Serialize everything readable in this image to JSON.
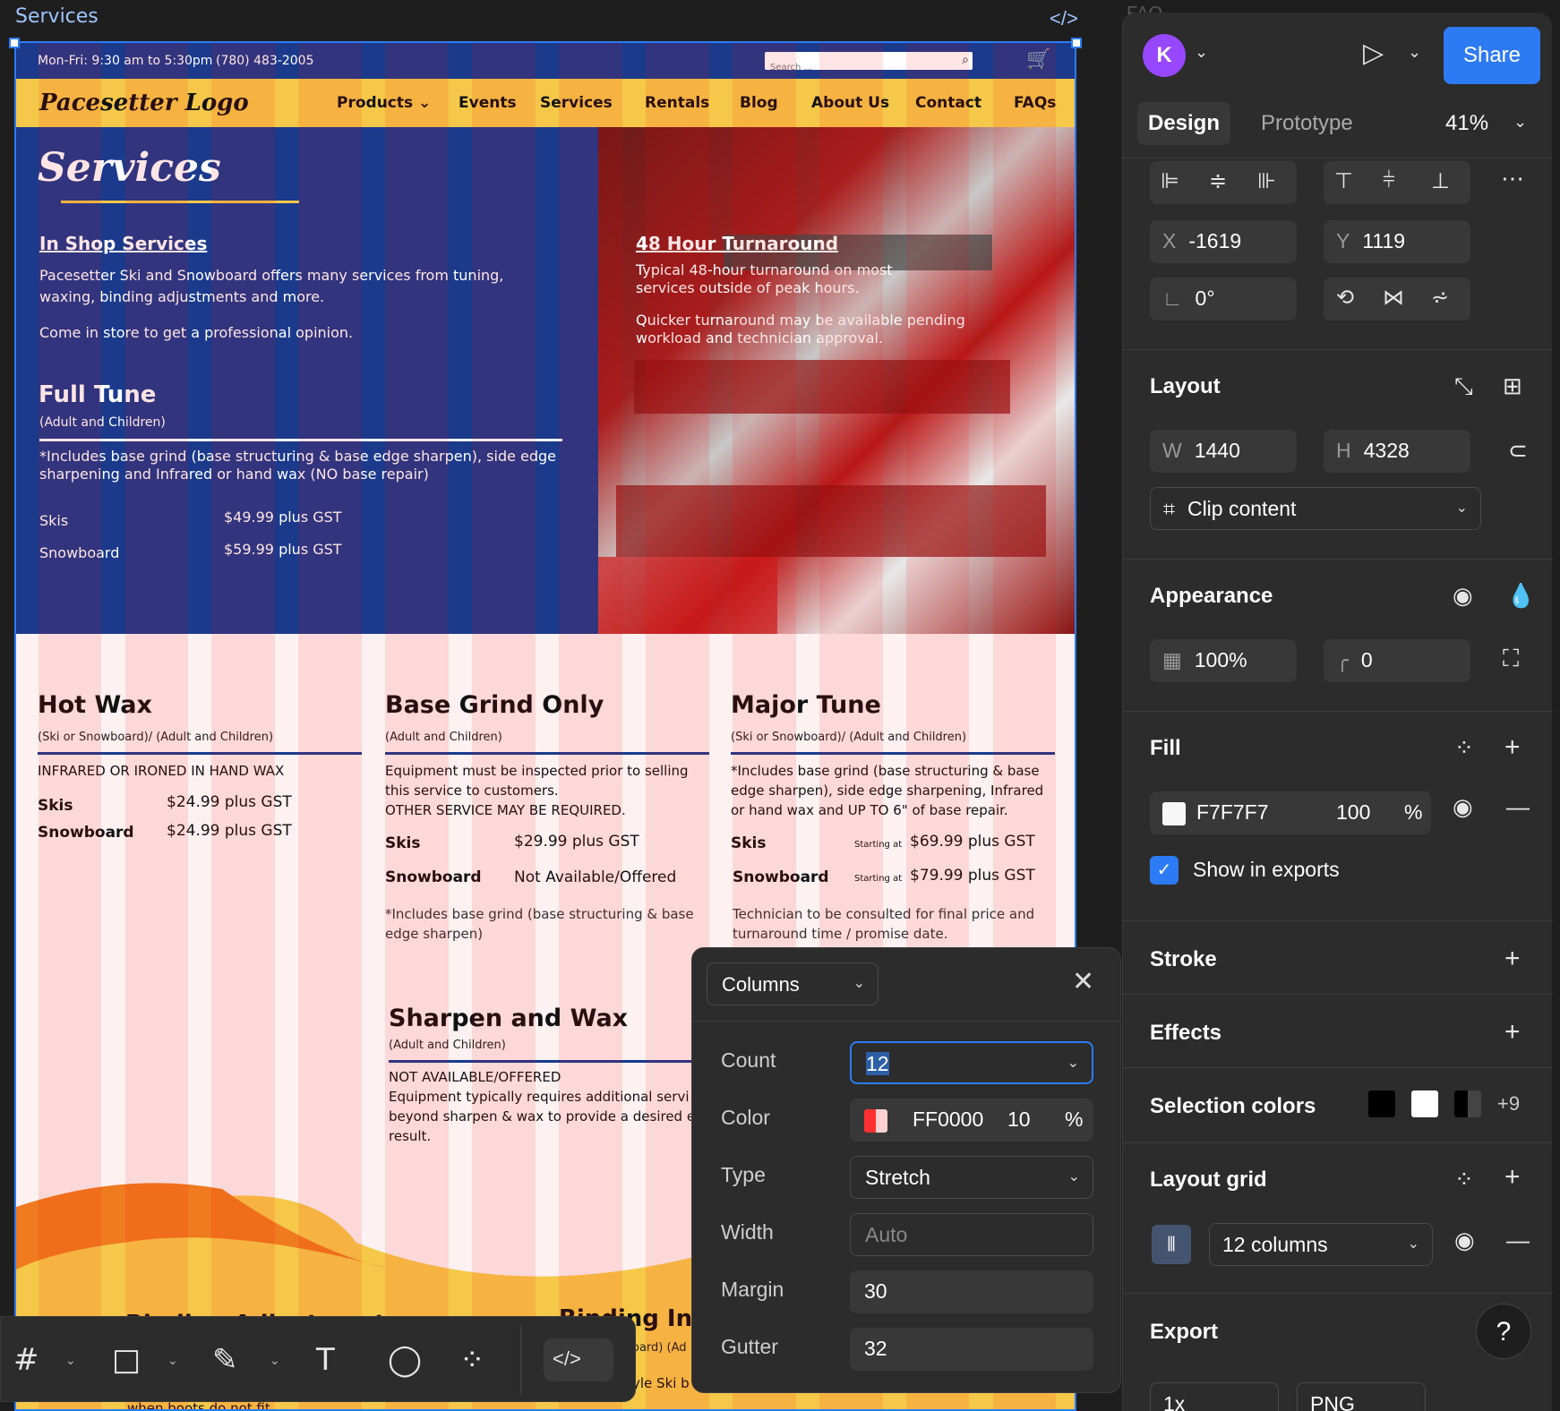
{
  "canvas": {
    "frame_label": "Services",
    "frame_label_right": "FAQ"
  },
  "site": {
    "hours": "Mon-Fri: 9:30 am to 5:30pm",
    "phone": "(780) 483-2005",
    "search_placeholder": "Search ...",
    "logo": "Pacesetter Logo",
    "nav": [
      "Products",
      "Events",
      "Services",
      "Rentals",
      "Blog",
      "About Us",
      "Contact",
      "FAQs"
    ],
    "title": "Services",
    "in_shop": {
      "heading": "In Shop Services",
      "p1": "Pacesetter Ski and Snowboard offers many services from tuning, waxing, binding adjustments and more.",
      "p2": "Come in store to get a professional opinion."
    },
    "full_tune": {
      "heading": "Full Tune",
      "sub": "(Adult and Children)",
      "desc": "*Includes base grind (base structuring & base edge sharpen), side edge sharpening and Infrared or hand wax (NO base repair)",
      "ski_lbl": "Skis",
      "ski_val": "$49.99 plus GST",
      "sb_lbl": "Snowboard",
      "sb_val": "$59.99 plus GST"
    },
    "turnaround": {
      "heading": "48 Hour Turnaround",
      "p1": "Typical 48-hour turnaround on most services outside of peak hours.",
      "p2": "Quicker turnaround may be available pending workload and technician approval."
    },
    "hot_wax": {
      "heading": "Hot Wax",
      "sub": "(Ski or Snowboard)/ (Adult and Children)",
      "desc": "INFRARED OR IRONED IN HAND WAX",
      "ski_lbl": "Skis",
      "ski_val": "$24.99 plus GST",
      "sb_lbl": "Snowboard",
      "sb_val": "$24.99 plus GST"
    },
    "base_grind": {
      "heading": "Base Grind Only",
      "sub": "(Adult and Children)",
      "desc": "Equipment must be inspected prior to selling this service to customers.\nOTHER SERVICE MAY BE REQUIRED.",
      "ski_lbl": "Skis",
      "ski_val": "$29.99 plus GST",
      "sb_lbl": "Snowboard",
      "sb_val": "Not Available/Offered",
      "note": "*Includes base grind (base structuring & base edge sharpen)"
    },
    "major_tune": {
      "heading": "Major Tune",
      "sub": "(Ski or Snowboard)/ (Adult and Children)",
      "desc": "*Includes base grind (base structuring & base edge sharpen), side edge sharpening, Infrared or hand wax and UP TO 6\" of base repair.",
      "ski_lbl": "Skis",
      "starting": "Starting at",
      "ski_val": "$69.99 plus GST",
      "sb_lbl": "Snowboard",
      "sb_val": "$79.99  plus GST",
      "note": "Technician to be consulted for final price and turnaround time / promise date."
    },
    "sharpen": {
      "heading": "Sharpen and Wax",
      "sub": "(Adult and Children)",
      "desc": "NOT AVAILABLE/OFFERED\nEquipment typically requires additional servi\nbeyond sharpen & wax to provide a desired e\nresult."
    },
    "partial1": "Binding Adjustment",
    "partial2": "Binding Ins",
    "partial3": "oard) (Ad",
    "partial4": "yle Ski b",
    "partial5": "when boots do not fit."
  },
  "columns_popup": {
    "type_select": "Columns",
    "count_lbl": "Count",
    "count": "12",
    "color_lbl": "Color",
    "color_hex": "FF0000",
    "color_opacity": "10",
    "pct": "%",
    "type_lbl": "Type",
    "type": "Stretch",
    "width_lbl": "Width",
    "width_placeholder": "Auto",
    "margin_lbl": "Margin",
    "margin": "30",
    "gutter_lbl": "Gutter",
    "gutter": "32"
  },
  "panel": {
    "avatar": "K",
    "share": "Share",
    "tab_design": "Design",
    "tab_prototype": "Prototype",
    "zoom": "41%",
    "x_lbl": "X",
    "x": "-1619",
    "y_lbl": "Y",
    "y": "1119",
    "rotation": "0°",
    "layout": "Layout",
    "w_lbl": "W",
    "w": "1440",
    "h_lbl": "H",
    "h": "4328",
    "clip": "Clip content",
    "appearance": "Appearance",
    "opacity": "100%",
    "radius": "0",
    "fill": "Fill",
    "fill_hex": "F7F7F7",
    "fill_opacity": "100",
    "pct": "%",
    "show_exports": "Show in exports",
    "stroke": "Stroke",
    "effects": "Effects",
    "selection_colors": "Selection colors",
    "more_colors": "+9",
    "layout_grid": "Layout grid",
    "grid_name": "12 columns",
    "export": "Export",
    "export_scale": "1x",
    "export_format": "PNG",
    "help": "?"
  },
  "colors": {
    "accent": "#2d7bf4",
    "site_blue": "#1b3a8c",
    "site_yellow": "#f5c84a",
    "avatar": "#9747ff"
  }
}
